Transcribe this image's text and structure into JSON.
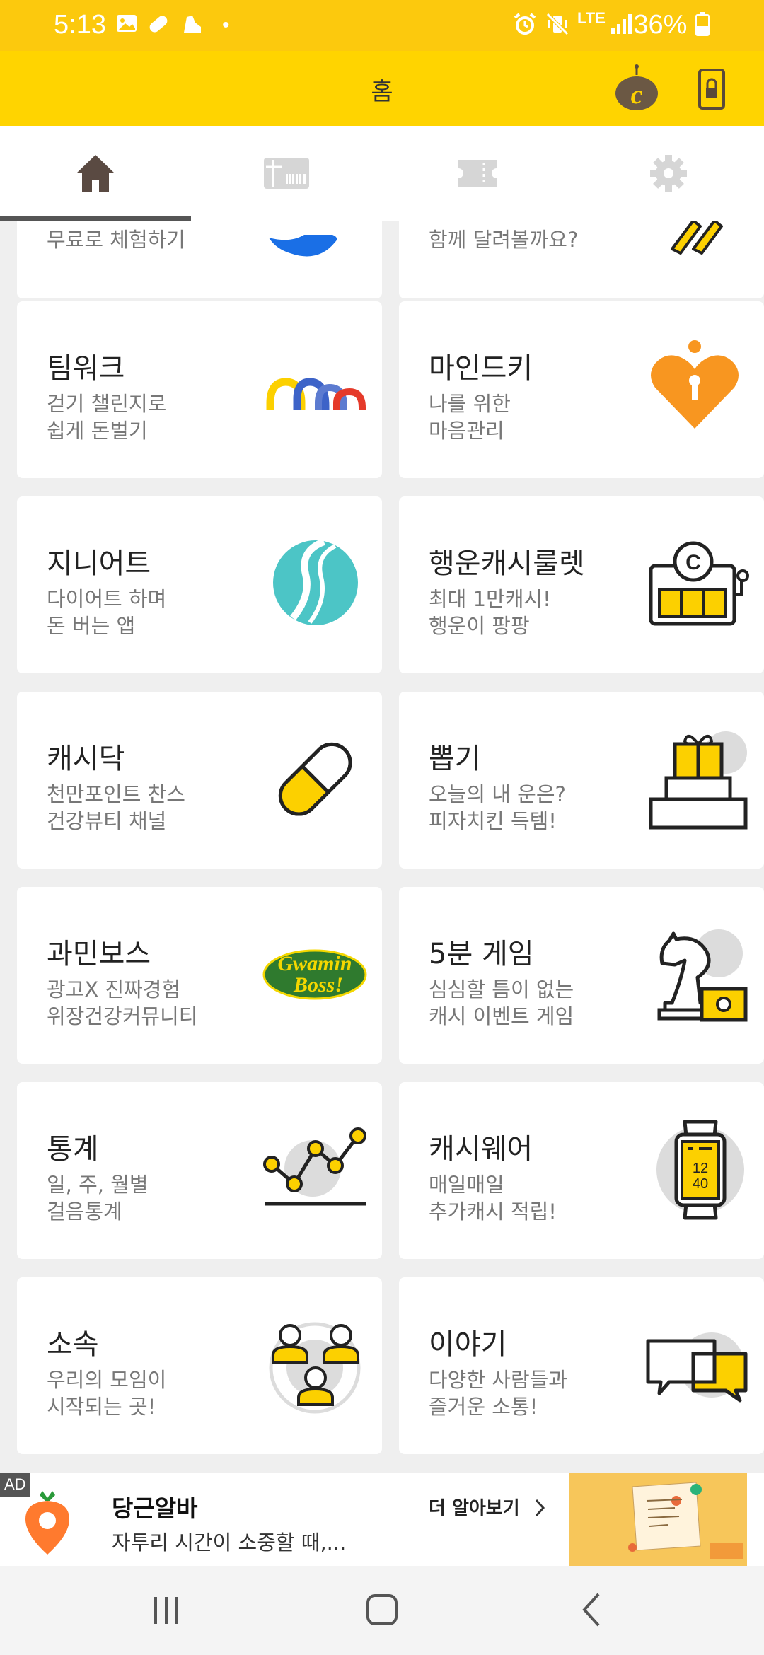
{
  "status_bar": {
    "time": "5:13",
    "battery": "36%",
    "network": "LTE"
  },
  "app_bar": {
    "title": "홈"
  },
  "tabs": [
    {
      "name": "home",
      "icon": "home-icon",
      "active": true
    },
    {
      "name": "gift",
      "icon": "gift-card-icon",
      "active": false
    },
    {
      "name": "coupon",
      "icon": "ticket-icon",
      "active": false
    },
    {
      "name": "settings",
      "icon": "gear-icon",
      "active": false
    }
  ],
  "partial_row": {
    "left_desc": "무료로 체험하기",
    "right_desc": "함께 달려볼까요?"
  },
  "cards": [
    {
      "title": "팀워크",
      "desc1": "걷기 챌린지로",
      "desc2": "쉽게 돈벌기",
      "icon": "teamwork-arches-icon"
    },
    {
      "title": "마인드키",
      "desc1": "나를 위한",
      "desc2": "마음관리",
      "icon": "heart-keyhole-icon"
    },
    {
      "title": "지니어트",
      "desc1": "다이어트 하며",
      "desc2": "돈 버는 앱",
      "icon": "genieat-logo-icon"
    },
    {
      "title": "행운캐시룰렛",
      "desc1": "최대 1만캐시!",
      "desc2": "행운이 팡팡",
      "icon": "slot-machine-icon"
    },
    {
      "title": "캐시닥",
      "desc1": "천만포인트 찬스",
      "desc2": "건강뷰티 채널",
      "icon": "pill-icon"
    },
    {
      "title": "뽑기",
      "desc1": "오늘의 내 운은?",
      "desc2": "피자치킨 득템!",
      "icon": "gift-boxes-icon"
    },
    {
      "title": "과민보스",
      "desc1": "광고X 진짜경험",
      "desc2": "위장건강커뮤니티",
      "icon": "gwamin-boss-logo-icon",
      "logo_text_1": "Gwamin",
      "logo_text_2": "Boss!"
    },
    {
      "title": "5분 게임",
      "desc1": "심심할 틈이 없는",
      "desc2": "캐시 이벤트 게임",
      "icon": "chess-knight-icon"
    },
    {
      "title": "통계",
      "desc1": "일, 주, 월별",
      "desc2": "걸음통계",
      "icon": "line-chart-icon"
    },
    {
      "title": "캐시웨어",
      "desc1": "매일매일",
      "desc2": "추가캐시 적립!",
      "icon": "smartwatch-icon",
      "watch_text_1": "12",
      "watch_text_2": "40"
    },
    {
      "title": "소속",
      "desc1": "우리의 모임이",
      "desc2": "시작되는 곳!",
      "icon": "group-people-icon"
    },
    {
      "title": "이야기",
      "desc1": "다양한 사람들과",
      "desc2": "즐거운 소통!",
      "icon": "chat-bubbles-icon"
    }
  ],
  "ad": {
    "label": "AD",
    "title": "당근알바",
    "description": "자투리 시간이 소중할 때,...",
    "cta": "더 알아보기"
  },
  "colors": {
    "accent": "#ffd400",
    "status_bar": "#fcc90d",
    "icon_yellow": "#fcd000",
    "icon_orange": "#f89620"
  }
}
